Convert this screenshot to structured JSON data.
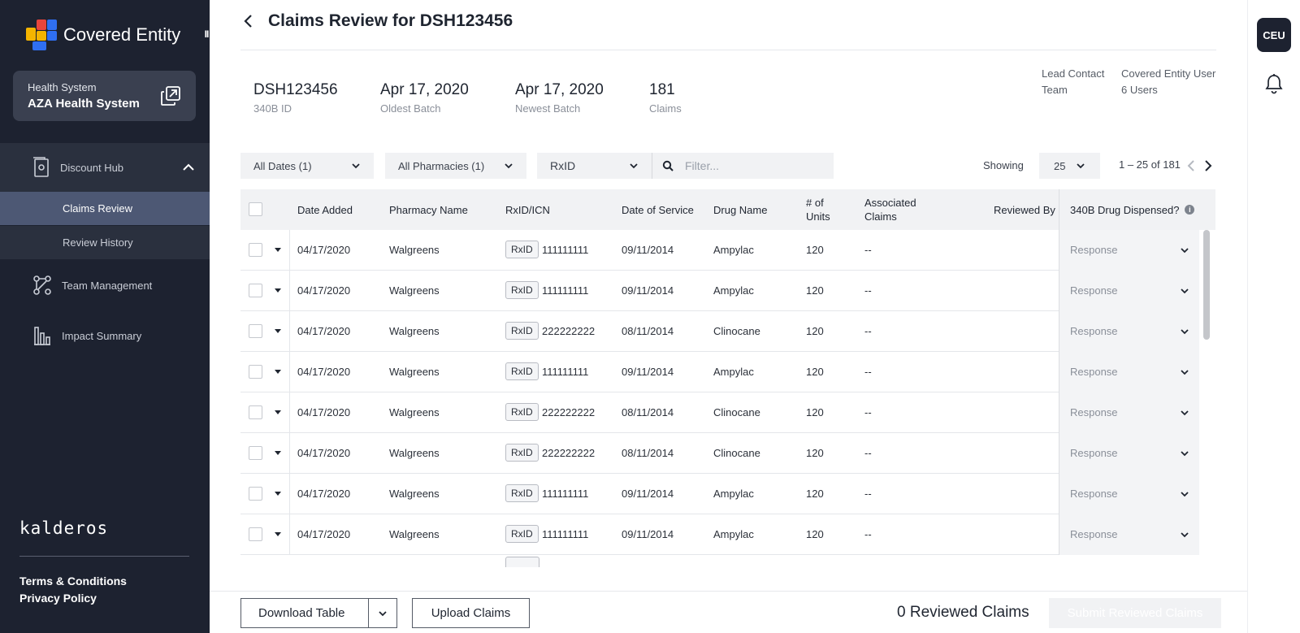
{
  "sidebar": {
    "brand": "Covered Entity",
    "collapse_glyph": "II",
    "health_system_label": "Health System",
    "health_system_name": "AZA Health System",
    "nav": {
      "discount_hub": "Discount Hub",
      "claims_review": "Claims Review",
      "review_history": "Review History",
      "team_management": "Team Management",
      "impact_summary": "Impact Summary"
    },
    "company": "kalderos",
    "links": {
      "terms": "Terms & Conditions",
      "privacy": "Privacy Policy"
    }
  },
  "header": {
    "title": "Claims Review for DSH123456"
  },
  "stats": [
    {
      "value": "DSH123456",
      "label": "340B ID"
    },
    {
      "value": "Apr 17, 2020",
      "label": "Oldest Batch"
    },
    {
      "value": "Apr 17, 2020",
      "label": "Newest Batch"
    },
    {
      "value": "181",
      "label": "Claims"
    }
  ],
  "contact": {
    "lead_label": "Lead Contact",
    "team_label": "Team",
    "lead_value": "Covered Entity User",
    "team_value": "6 Users"
  },
  "filters": {
    "dates": "All Dates (1)",
    "pharmacies": "All Pharmacies (1)",
    "id_type": "RxID",
    "search_placeholder": "Filter...",
    "showing_label": "Showing",
    "page_size": "25",
    "range": "1 – 25 of 181"
  },
  "table": {
    "columns": {
      "date_added": "Date Added",
      "pharmacy": "Pharmacy Name",
      "rxid": "RxID/ICN",
      "dos": "Date of Service",
      "drug": "Drug Name",
      "units": "# of Units",
      "assoc": "Associated Claims",
      "reviewed_by": "Reviewed By",
      "dispensed": "340B Drug Dispensed?"
    },
    "rows": [
      {
        "date": "04/17/2020",
        "pharmacy": "Walgreens",
        "badge": "RxID",
        "rxid": "111111111",
        "dos": "09/11/2014",
        "drug": "Ampylac",
        "units": "120",
        "assoc": "--",
        "response": "Response"
      },
      {
        "date": "04/17/2020",
        "pharmacy": "Walgreens",
        "badge": "RxID",
        "rxid": "111111111",
        "dos": "09/11/2014",
        "drug": "Ampylac",
        "units": "120",
        "assoc": "--",
        "response": "Response"
      },
      {
        "date": "04/17/2020",
        "pharmacy": "Walgreens",
        "badge": "RxID",
        "rxid": "222222222",
        "dos": "08/11/2014",
        "drug": "Clinocane",
        "units": "120",
        "assoc": "--",
        "response": "Response"
      },
      {
        "date": "04/17/2020",
        "pharmacy": "Walgreens",
        "badge": "RxID",
        "rxid": "111111111",
        "dos": "09/11/2014",
        "drug": "Ampylac",
        "units": "120",
        "assoc": "--",
        "response": "Response"
      },
      {
        "date": "04/17/2020",
        "pharmacy": "Walgreens",
        "badge": "RxID",
        "rxid": "222222222",
        "dos": "08/11/2014",
        "drug": "Clinocane",
        "units": "120",
        "assoc": "--",
        "response": "Response"
      },
      {
        "date": "04/17/2020",
        "pharmacy": "Walgreens",
        "badge": "RxID",
        "rxid": "222222222",
        "dos": "08/11/2014",
        "drug": "Clinocane",
        "units": "120",
        "assoc": "--",
        "response": "Response"
      },
      {
        "date": "04/17/2020",
        "pharmacy": "Walgreens",
        "badge": "RxID",
        "rxid": "111111111",
        "dos": "09/11/2014",
        "drug": "Ampylac",
        "units": "120",
        "assoc": "--",
        "response": "Response"
      },
      {
        "date": "04/17/2020",
        "pharmacy": "Walgreens",
        "badge": "RxID",
        "rxid": "111111111",
        "dos": "09/11/2014",
        "drug": "Ampylac",
        "units": "120",
        "assoc": "--",
        "response": "Response"
      }
    ]
  },
  "bottom": {
    "download_label": "Download Table",
    "upload_label": "Upload Claims",
    "reviewed_count": "0 Reviewed Claims",
    "submit_label": "Submit Reviewed Claims"
  },
  "user": {
    "initials": "CEU"
  },
  "icons": {
    "logo": "covered-entity-logo",
    "switch": "switch-icon",
    "discount_hub": "document-icon",
    "team": "nodes-icon",
    "impact": "bar-chart-icon",
    "back": "chevron-left-icon",
    "search": "search-icon",
    "info": "info-icon",
    "bell": "bell-icon"
  },
  "colors": {
    "sidebar_bg": "#1d2230",
    "active_nav": "#4d5874",
    "card_bg": "#3a4050",
    "logo_yellow": "#f4b400",
    "logo_red": "#e8453c",
    "logo_blue": "#2f6ff2"
  }
}
